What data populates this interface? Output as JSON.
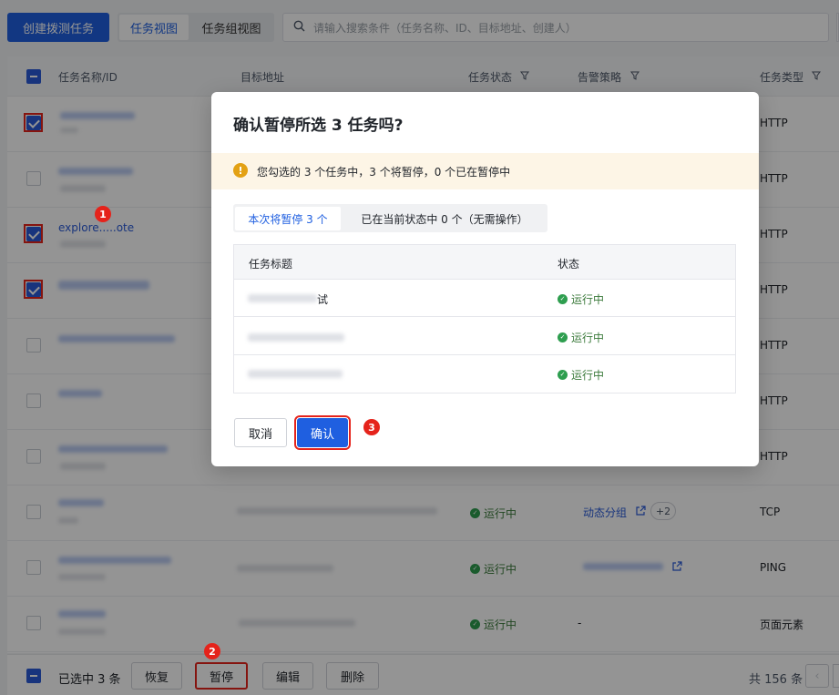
{
  "toolbar": {
    "create_label": "创建拨测任务",
    "view_task": "任务视图",
    "view_group": "任务组视图",
    "search_placeholder": "请输入搜索条件（任务名称、ID、目标地址、创建人）"
  },
  "table": {
    "headers": [
      "任务名称/ID",
      "目标地址",
      "任务状态",
      "告警策略",
      "任务类型"
    ],
    "rows": [
      {
        "type": "HTTP",
        "checked": true
      },
      {
        "type": "HTTP",
        "checked": false
      },
      {
        "type": "HTTP",
        "checked": true,
        "name_fragment": "explore.....ote"
      },
      {
        "type": "HTTP",
        "checked": true
      },
      {
        "type": "HTTP",
        "checked": false
      },
      {
        "type": "HTTP",
        "checked": false
      },
      {
        "type": "HTTP",
        "checked": false
      },
      {
        "type": "TCP",
        "checked": false,
        "status": "运行中",
        "alarm": "动态分组",
        "alarm_extra": "+2"
      },
      {
        "type": "PING",
        "checked": false,
        "status": "运行中"
      },
      {
        "type": "页面元素",
        "checked": false,
        "status": "运行中",
        "alarm": "-"
      }
    ]
  },
  "footer": {
    "selected": "已选中 3 条",
    "resume": "恢复",
    "pause": "暂停",
    "edit": "编辑",
    "delete": "删除",
    "total": "共 156 条"
  },
  "modal": {
    "title": "确认暂停所选 3 任务吗?",
    "warning": "您勾选的 3 个任务中，3 个将暂停，0 个已在暂停中",
    "tab_active": "本次将暂停 3 个",
    "tab_other": "已在当前状态中 0 个（无需操作）",
    "col_title": "任务标题",
    "col_status": "状态",
    "rows": [
      {
        "status": "运行中",
        "title_fragment": "试"
      },
      {
        "status": "运行中"
      },
      {
        "status": "运行中"
      }
    ],
    "cancel": "取消",
    "confirm": "确认"
  },
  "annotations": [
    "1",
    "2",
    "3"
  ],
  "colors": {
    "primary": "#1f5fe0",
    "highlight": "#e5231b",
    "running": "#2e9e4f",
    "warning": "#e3a114"
  }
}
